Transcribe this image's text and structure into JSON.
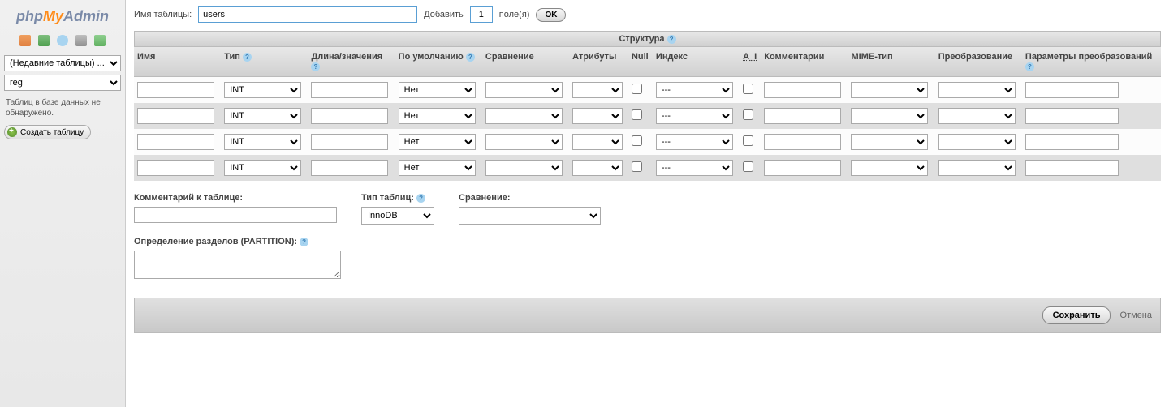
{
  "logo": {
    "php": "php",
    "my": "My",
    "admin": "Admin"
  },
  "sidebar": {
    "recent_placeholder": "(Недавние таблицы) ...",
    "db_selected": "reg",
    "no_tables_msg": "Таблиц в базе данных не обнаружено.",
    "create_btn": "Создать таблицу"
  },
  "top": {
    "tablename_label": "Имя таблицы:",
    "tablename_value": "users",
    "add_label": "Добавить",
    "add_count": "1",
    "fields_label": "поле(я)",
    "ok": "OK"
  },
  "structure_header": "Структура",
  "headers": {
    "name": "Имя",
    "type": "Тип",
    "length": "Длина/значения",
    "default": "По умолчанию",
    "collation": "Сравнение",
    "attributes": "Атрибуты",
    "null": "Null",
    "index": "Индекс",
    "ai": "A_I",
    "comments": "Комментарии",
    "mime": "MIME-тип",
    "transform": "Преобразование",
    "transform_opts": "Параметры преобразований"
  },
  "row_defaults": {
    "type": "INT",
    "default": "Нет",
    "index": "---"
  },
  "meta": {
    "table_comment_label": "Комментарий к таблице:",
    "storage_label": "Тип таблиц:",
    "storage_value": "InnoDB",
    "collation_label": "Сравнение:",
    "partition_label": "Определение разделов (PARTITION):"
  },
  "footer": {
    "save": "Сохранить",
    "cancel": "Отмена"
  }
}
